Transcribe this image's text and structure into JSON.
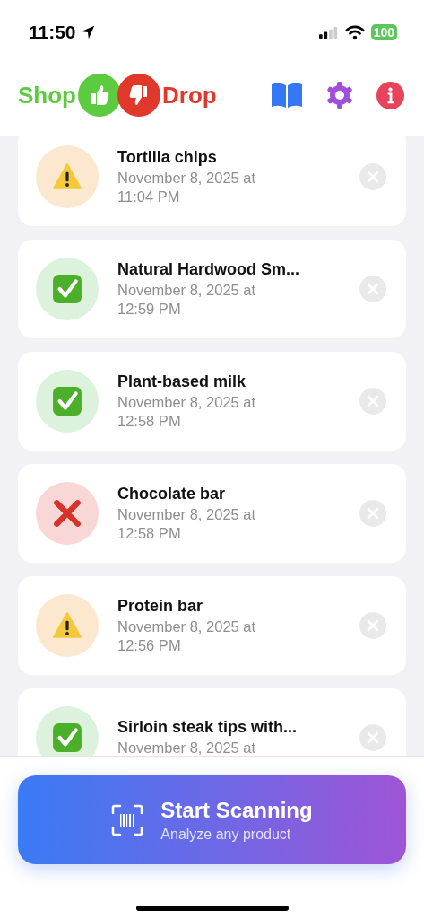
{
  "status_bar": {
    "time": "11:50",
    "battery": "100"
  },
  "header": {
    "brand_left": "Shop",
    "brand_right": "Drop"
  },
  "items": [
    {
      "name": "Tortilla chips",
      "date": "November 8, 2025 at 11:04 PM",
      "kind": "warning"
    },
    {
      "name": "Natural Hardwood Sm...",
      "date": "November 8, 2025 at 12:59 PM",
      "kind": "good"
    },
    {
      "name": "Plant-based milk",
      "date": "November 8, 2025 at 12:58 PM",
      "kind": "good"
    },
    {
      "name": "Chocolate bar",
      "date": "November 8, 2025 at 12:58 PM",
      "kind": "bad"
    },
    {
      "name": "Protein bar",
      "date": "November 8, 2025 at 12:56 PM",
      "kind": "warning"
    },
    {
      "name": "Sirloin steak tips with...",
      "date": "November 8, 2025 at",
      "kind": "good"
    }
  ],
  "scan_button": {
    "title": "Start Scanning",
    "subtitle": "Analyze any product"
  }
}
